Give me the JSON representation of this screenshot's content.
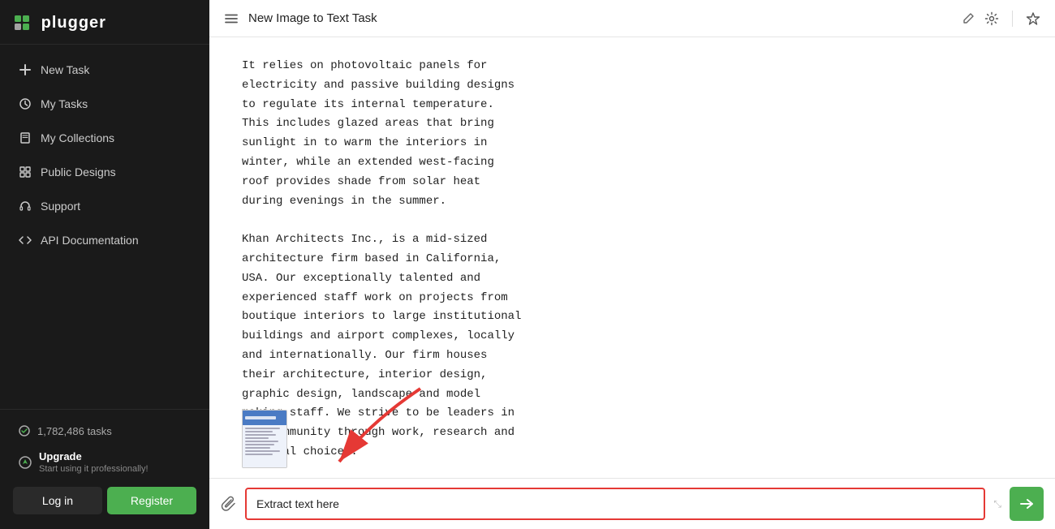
{
  "app": {
    "logo": "plugger",
    "logo_dot": "●"
  },
  "sidebar": {
    "nav_items": [
      {
        "id": "new-task",
        "label": "New Task",
        "icon": "plus"
      },
      {
        "id": "my-tasks",
        "label": "My Tasks",
        "icon": "clock"
      },
      {
        "id": "my-collections",
        "label": "My Collections",
        "icon": "bookmark"
      },
      {
        "id": "public-designs",
        "label": "Public Designs",
        "icon": "grid"
      },
      {
        "id": "support",
        "label": "Support",
        "icon": "headset"
      },
      {
        "id": "api-docs",
        "label": "API Documentation",
        "icon": "code"
      }
    ],
    "tasks_count": "1,782,486 tasks",
    "upgrade_title": "Upgrade",
    "upgrade_sub": "Start using it professionally!",
    "login_label": "Log in",
    "register_label": "Register"
  },
  "topbar": {
    "title": "New Image to Text Task",
    "menu_icon": "☰",
    "edit_icon": "✎",
    "settings_icon": "⚙",
    "star_icon": "☆"
  },
  "content": {
    "text": "It relies on photovoltaic panels for\nelectricity and passive building designs\nto regulate its internal temperature.\nThis includes glazed areas that bring\nsunlight in to warm the interiors in\nwinter, while an extended west-facing\nroof provides shade from solar heat\nduring evenings in the summer.\n\nKhan Architects Inc., is a mid-sized\narchitecture firm based in California,\nUSA. Our exceptionally talented and\nexperienced staff work on projects from\nboutique interiors to large institutional\nbuildings and airport complexes, locally\nand internationally. Our firm houses\ntheir architecture, interior design,\ngraphic design, landscape and model\nmaking staff. We strive to be leaders in\nthe community through work, research and\npersonal choices."
  },
  "input": {
    "placeholder": "Extract text here",
    "value": "Extract text here",
    "attach_icon": "📎",
    "send_icon": "➤"
  }
}
